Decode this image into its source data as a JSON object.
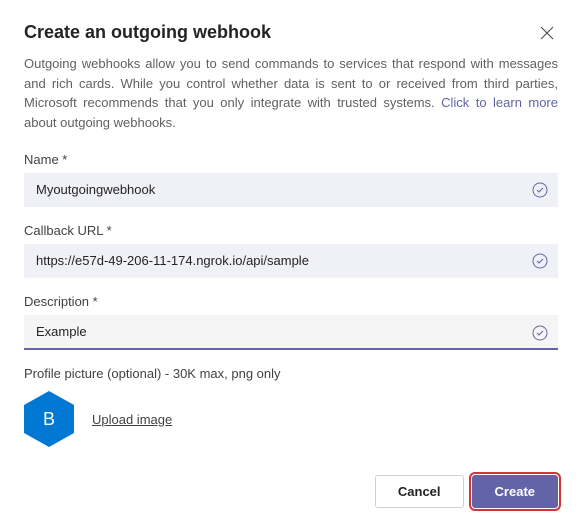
{
  "header": {
    "title": "Create an outgoing webhook"
  },
  "description": {
    "text_before_link": "Outgoing webhooks allow you to send commands to services that respond with messages and rich cards. While you control whether data is sent to or received from third parties, Microsoft recommends that you only integrate with trusted systems. ",
    "link_text": "Click to learn more",
    "text_after_link": " about outgoing webhooks."
  },
  "fields": {
    "name": {
      "label": "Name *",
      "value": "Myoutgoingwebhook"
    },
    "callback_url": {
      "label": "Callback URL *",
      "value": "https://e57d-49-206-11-174.ngrok.io/api/sample"
    },
    "description": {
      "label": "Description *",
      "value": "Example"
    }
  },
  "profile_picture": {
    "label": "Profile picture (optional) - 30K max, png only",
    "avatar_letter": "B",
    "upload_label": "Upload image"
  },
  "footer": {
    "cancel_label": "Cancel",
    "create_label": "Create"
  },
  "colors": {
    "primary": "#6264a7",
    "profile_bg": "#0078d4",
    "highlight_outline": "#d13438"
  }
}
